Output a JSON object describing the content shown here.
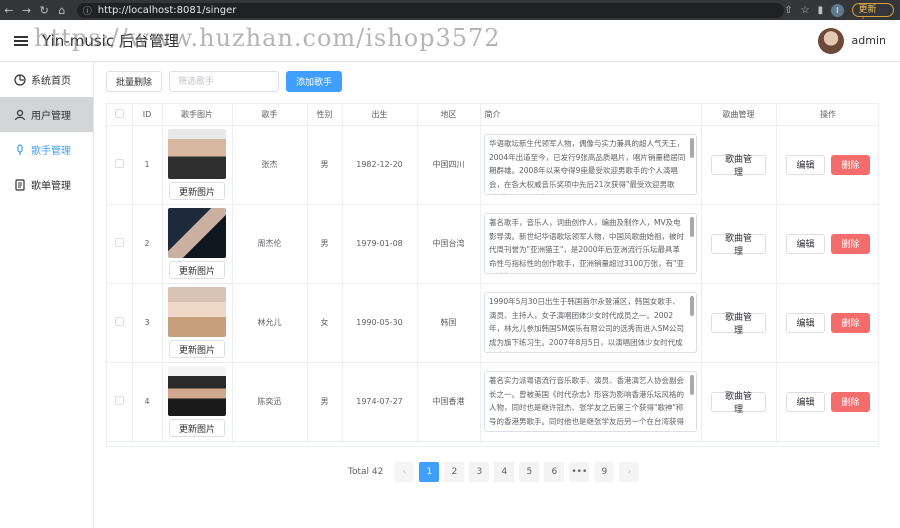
{
  "browser": {
    "url": "http://localhost:8081/singer",
    "update_label": "更新",
    "profile_letter": "I"
  },
  "header": {
    "title": "Yin-music 后台管理",
    "watermark": "https://www.huzhan.com/ishop3572",
    "username": "admin"
  },
  "sidebar": {
    "items": [
      {
        "label": "系统首页"
      },
      {
        "label": "用户管理"
      },
      {
        "label": "歌手管理"
      },
      {
        "label": "歌单管理"
      }
    ]
  },
  "toolbar": {
    "batch_delete_label": "批量删除",
    "search_placeholder": "筛选歌手",
    "add_singer_label": "添加歌手"
  },
  "table": {
    "columns": [
      "ID",
      "歌手图片",
      "歌手",
      "性别",
      "出生",
      "地区",
      "简介",
      "歌曲管理",
      "操作"
    ],
    "update_pic_label": "更新图片",
    "song_manage_label": "歌曲管理",
    "edit_label": "编辑",
    "delete_label": "删除",
    "rows": [
      {
        "id": "1",
        "name": "张杰",
        "sex": "男",
        "birth": "1982-12-20",
        "location": "中国四川",
        "intro": "华语歌坛新生代领军人物，偶像与实力兼具的超人气天王，2004年出道至今，已发行9张高品质唱片，唱片销量稳居同期群雄。2008年以来夺得9座最受欢迎男歌手的个人演唱会，在各大权威音乐奖项中先后21次获得\"最受欢迎男歌手\"称号，2012年"
      },
      {
        "id": "2",
        "name": "周杰伦",
        "sex": "男",
        "birth": "1979-01-08",
        "location": "中国台湾",
        "intro": "著名歌手，音乐人，词曲创作人，编曲及制作人，MV及电影导演。新世纪华语歌坛领军人物，中国风歌曲始祖，被时代周刊誉为\"亚洲猫王\"，是2000年后亚洲流行乐坛最具革命性与指标性的创作歌手，亚洲销量超过3100万张，有\"亚洲流行"
      },
      {
        "id": "3",
        "name": "林允儿",
        "sex": "女",
        "birth": "1990-05-30",
        "location": "韩国",
        "intro": "1990年5月30日出生于韩国首尔永登浦区，韩国女歌手、演员、主持人，女子演唱团体少女时代成员之一。2002年，林允儿参加韩国SM娱乐有限公司的选秀而进入SM公司成为旗下练习生。2007年8月5日，以演唱团体少女时代成员身份正"
      },
      {
        "id": "4",
        "name": "陈奕迅",
        "sex": "男",
        "birth": "1974-07-27",
        "location": "中国香港",
        "intro": "著名实力派粤语流行音乐歌手、演员、香港演艺人协会副会长之一。曾被美国《时代杂志》形容为影响香港乐坛风格的人物，同时也是继许冠杰、张学友之后第三个获得\"歌神\"称号的香港男歌手。同时他也是继张学友后另一个在台湾获得"
      }
    ]
  },
  "pagination": {
    "total_label": "Total 42",
    "pages": [
      "1",
      "2",
      "3",
      "4",
      "5",
      "6",
      "•••",
      "9"
    ],
    "current": "1",
    "prev": "‹",
    "next": "›"
  },
  "colors": {
    "primary": "#409eff",
    "danger": "#f56c6c",
    "sidebar_active_bg": "#d3d4d6"
  }
}
